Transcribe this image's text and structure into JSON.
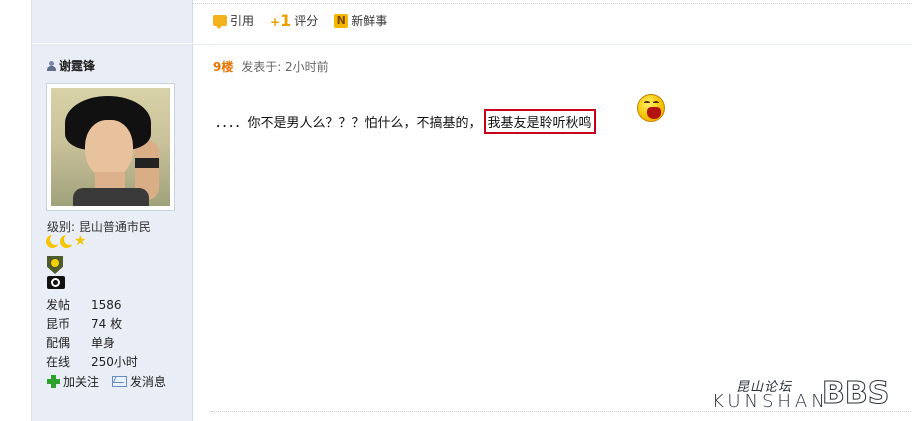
{
  "toolbar": {
    "quote_label": "引用",
    "rate_label": "评分",
    "news_label": "新鲜事",
    "rate_prefix": "+",
    "rate_num": "1",
    "news_glyph": "N"
  },
  "post": {
    "floor": "9楼",
    "posted_at": "发表于: 2小时前",
    "text_before": "．．．．你不是男人么？？？怕什么，不搞基的，",
    "text_highlight": "我基友是聆听秋鸣",
    "emoji": "laughing-face-icon"
  },
  "user": {
    "name": "谢霆锋",
    "level_label": "级别: 昆山普通市民",
    "stats": [
      {
        "key": "发帖",
        "value": "1586"
      },
      {
        "key": "昆币",
        "value": "74 枚"
      },
      {
        "key": "配偶",
        "value": "单身"
      },
      {
        "key": "在线",
        "value": "250小时"
      }
    ],
    "follow_label": "加关注",
    "message_label": "发消息"
  },
  "watermark": {
    "cn": "昆山论坛",
    "en": "KUNSHAN",
    "bbs": "BBS"
  },
  "colors": {
    "sidebar_bg": "#e9eef6",
    "floor": "#e87500",
    "highlight_border": "#c8001e"
  }
}
